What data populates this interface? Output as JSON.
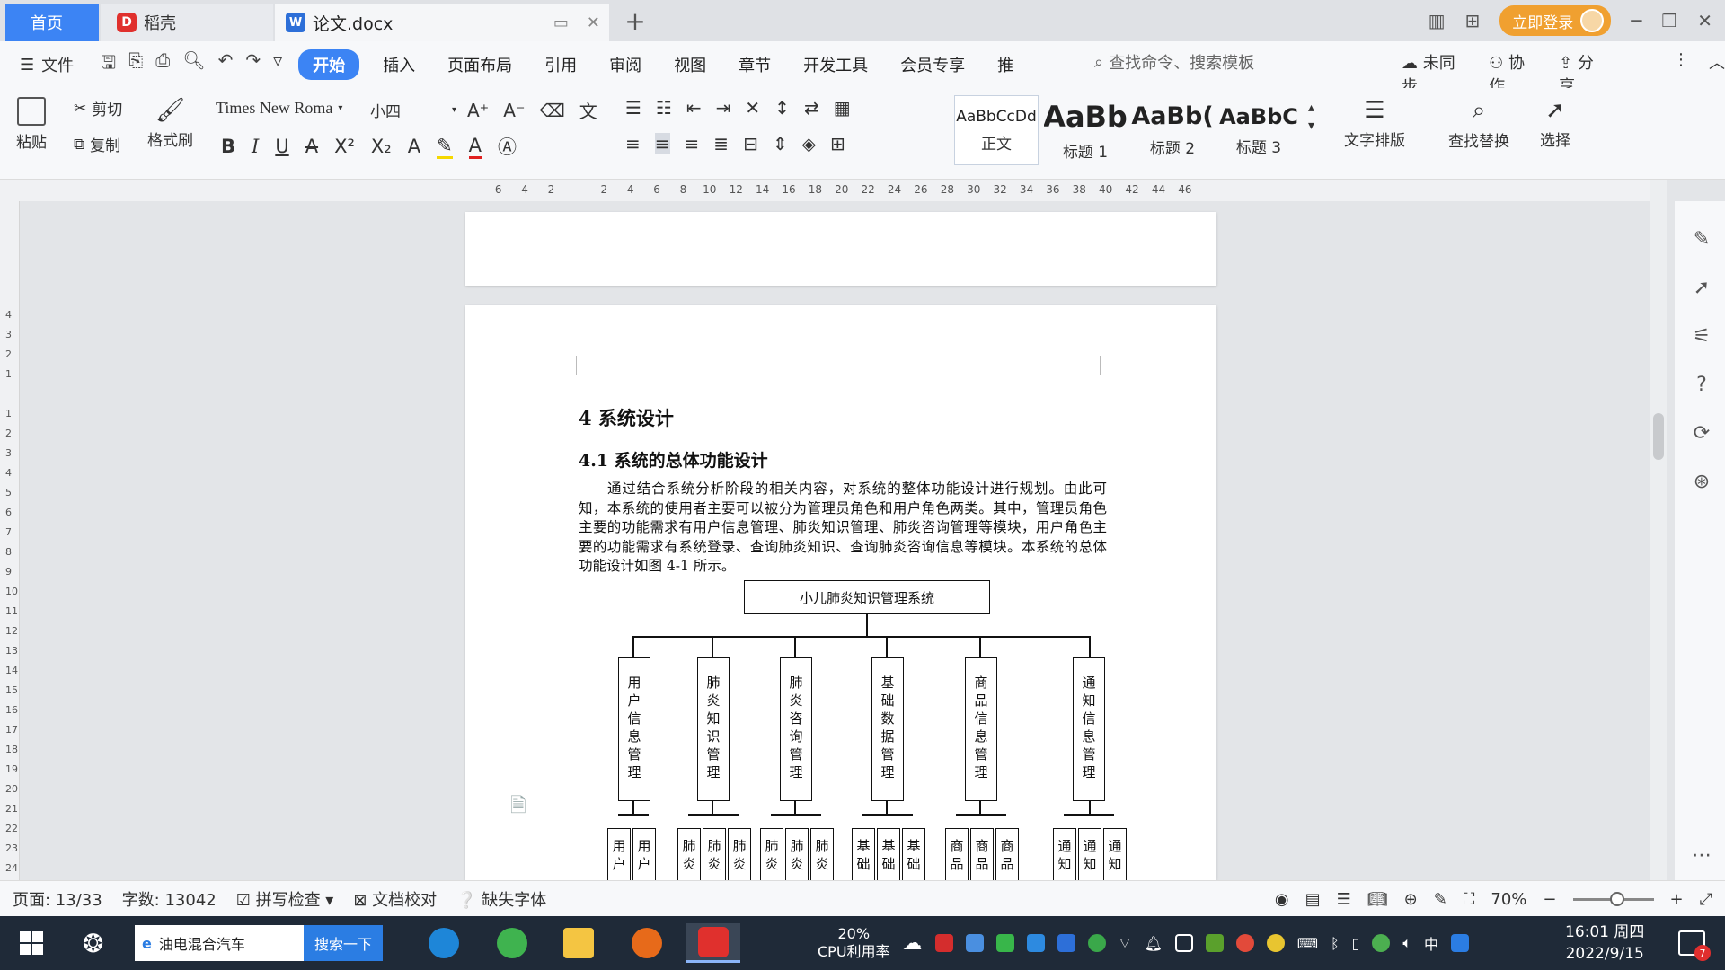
{
  "tabs": {
    "home": "首页",
    "daoke": "稻壳",
    "document": "论文.docx",
    "daoke_logo": "D",
    "doc_logo": "W"
  },
  "window": {
    "login_label": "立即登录"
  },
  "menubar": {
    "file_label": "文件",
    "items": [
      "开始",
      "插入",
      "页面布局",
      "引用",
      "审阅",
      "视图",
      "章节",
      "开发工具",
      "会员专享",
      "推"
    ],
    "search_placeholder": "查找命令、搜索模板",
    "sync_label": "未同步",
    "collab_label": "协作",
    "share_label": "分享"
  },
  "ribbon": {
    "paste": "粘贴",
    "cut": "剪切",
    "copy": "复制",
    "format_painter": "格式刷",
    "font_name": "Times New Roma",
    "font_size": "小四",
    "styles": [
      {
        "sample": "AaBbCcDd",
        "name": "正文"
      },
      {
        "sample": "AaBb",
        "name": "标题 1"
      },
      {
        "sample": "AaBb(",
        "name": "标题 2"
      },
      {
        "sample": "AaBbC",
        "name": "标题 3"
      }
    ],
    "text_layout": "文字排版",
    "find_replace": "查找替换",
    "select": "选择"
  },
  "ruler": {
    "h_ticks": [
      "6",
      "4",
      "2",
      "",
      "2",
      "4",
      "6",
      "8",
      "10",
      "12",
      "14",
      "16",
      "18",
      "20",
      "22",
      "24",
      "26",
      "28",
      "30",
      "32",
      "34",
      "36",
      "38",
      "40",
      "42",
      "44",
      "46"
    ],
    "v_ticks": [
      "4",
      "3",
      "2",
      "1",
      "",
      "1",
      "2",
      "3",
      "4",
      "5",
      "6",
      "7",
      "8",
      "9",
      "10",
      "11",
      "12",
      "13",
      "14",
      "15",
      "16",
      "17",
      "18",
      "19",
      "20",
      "21",
      "22",
      "23",
      "24"
    ]
  },
  "document": {
    "heading1": "4 系统设计",
    "heading2": "4.1 系统的总体功能设计",
    "paragraph": "通过结合系统分析阶段的相关内容，对系统的整体功能设计进行规划。由此可知，本系统的使用者主要可以被分为管理员角色和用户角色两类。其中，管理员角色主要的功能需求有用户信息管理、肺炎知识管理、肺炎咨询管理等模块，用户角色主要的功能需求有系统登录、查询肺炎知识、查询肺炎咨询信息等模块。本系统的总体功能设计如图 4-1 所示。",
    "diagram": {
      "root": "小儿肺炎知识管理系统",
      "modules": [
        {
          "label": "用户信息管理",
          "children": [
            "用户",
            "用户"
          ]
        },
        {
          "label": "肺炎知识管理",
          "children": [
            "肺炎",
            "肺炎",
            "肺炎"
          ]
        },
        {
          "label": "肺炎咨询管理",
          "children": [
            "肺炎",
            "肺炎",
            "肺炎"
          ]
        },
        {
          "label": "基础数据管理",
          "children": [
            "基础",
            "基础",
            "基础"
          ]
        },
        {
          "label": "商品信息管理",
          "children": [
            "商品",
            "商品",
            "商品"
          ]
        },
        {
          "label": "通知信息管理",
          "children": [
            "通知",
            "通知",
            "通知"
          ]
        }
      ]
    }
  },
  "statusbar": {
    "page": "页面: 13/33",
    "word_count": "字数: 13042",
    "spell_check": "拼写检查",
    "doc_proof": "文档校对",
    "missing_fonts": "缺失字体",
    "zoom": "70%",
    "zoom_level": 0.55
  },
  "taskbar": {
    "search_text": "油电混合汽车",
    "search_button": "搜索一下",
    "cpu_percent": "20%",
    "cpu_label": "CPU利用率",
    "ime": "中",
    "time": "16:01 周四",
    "date": "2022/9/15",
    "notification_count": "7"
  }
}
